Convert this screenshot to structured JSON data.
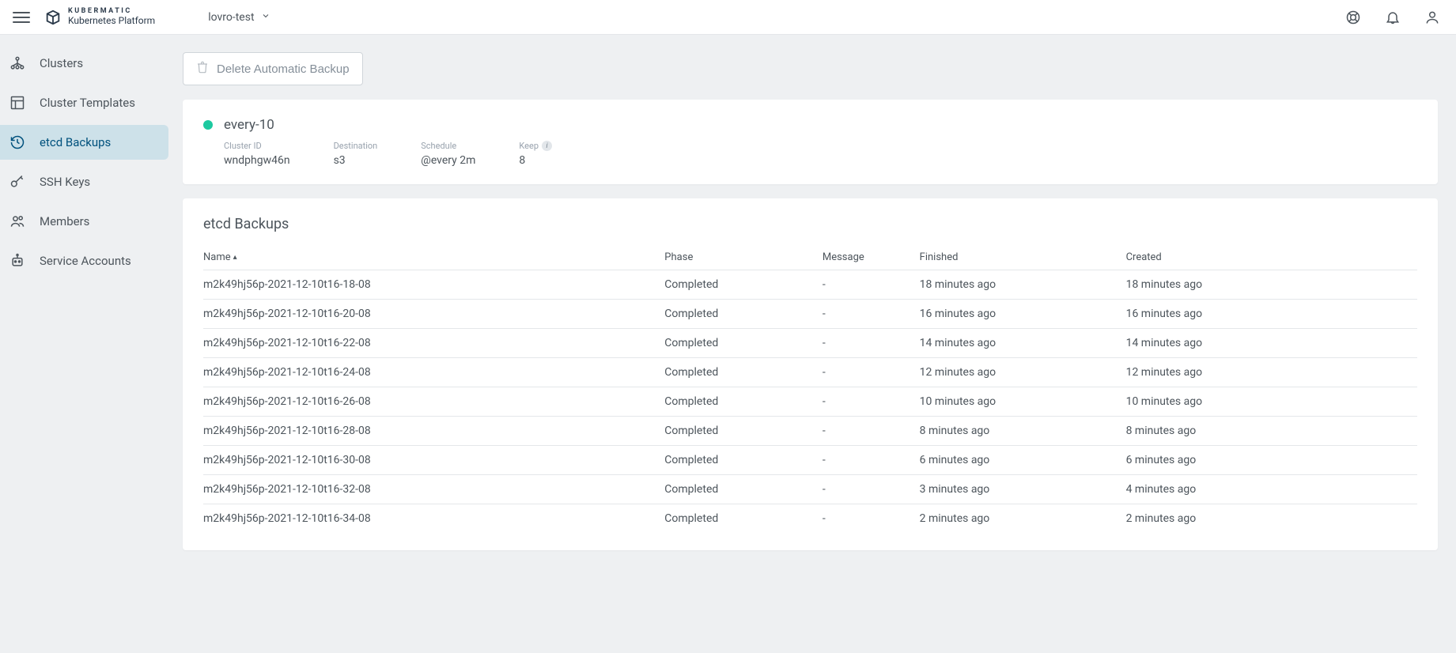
{
  "header": {
    "brand_top": "KUBERMATIC",
    "brand_bottom": "Kubernetes Platform",
    "project": "lovro-test"
  },
  "sidebar": {
    "items": [
      {
        "label": "Clusters"
      },
      {
        "label": "Cluster Templates"
      },
      {
        "label": "etcd Backups"
      },
      {
        "label": "SSH Keys"
      },
      {
        "label": "Members"
      },
      {
        "label": "Service Accounts"
      }
    ],
    "active_index": 2
  },
  "actions": {
    "delete_label": "Delete Automatic Backup"
  },
  "summary": {
    "name": "every-10",
    "fields": {
      "cluster": {
        "label": "Cluster ID",
        "value": "wndphgw46n"
      },
      "destination": {
        "label": "Destination",
        "value": "s3"
      },
      "schedule": {
        "label": "Schedule",
        "value": "@every 2m"
      },
      "keep": {
        "label": "Keep",
        "value": "8"
      }
    }
  },
  "table": {
    "title": "etcd Backups",
    "columns": {
      "name": "Name",
      "phase": "Phase",
      "message": "Message",
      "finished": "Finished",
      "created": "Created"
    },
    "rows": [
      {
        "name": "m2k49hj56p-2021-12-10t16-18-08",
        "phase": "Completed",
        "message": "-",
        "finished": "18 minutes ago",
        "created": "18 minutes ago"
      },
      {
        "name": "m2k49hj56p-2021-12-10t16-20-08",
        "phase": "Completed",
        "message": "-",
        "finished": "16 minutes ago",
        "created": "16 minutes ago"
      },
      {
        "name": "m2k49hj56p-2021-12-10t16-22-08",
        "phase": "Completed",
        "message": "-",
        "finished": "14 minutes ago",
        "created": "14 minutes ago"
      },
      {
        "name": "m2k49hj56p-2021-12-10t16-24-08",
        "phase": "Completed",
        "message": "-",
        "finished": "12 minutes ago",
        "created": "12 minutes ago"
      },
      {
        "name": "m2k49hj56p-2021-12-10t16-26-08",
        "phase": "Completed",
        "message": "-",
        "finished": "10 minutes ago",
        "created": "10 minutes ago"
      },
      {
        "name": "m2k49hj56p-2021-12-10t16-28-08",
        "phase": "Completed",
        "message": "-",
        "finished": "8 minutes ago",
        "created": "8 minutes ago"
      },
      {
        "name": "m2k49hj56p-2021-12-10t16-30-08",
        "phase": "Completed",
        "message": "-",
        "finished": "6 minutes ago",
        "created": "6 minutes ago"
      },
      {
        "name": "m2k49hj56p-2021-12-10t16-32-08",
        "phase": "Completed",
        "message": "-",
        "finished": "3 minutes ago",
        "created": "4 minutes ago"
      },
      {
        "name": "m2k49hj56p-2021-12-10t16-34-08",
        "phase": "Completed",
        "message": "-",
        "finished": "2 minutes ago",
        "created": "2 minutes ago"
      }
    ]
  }
}
